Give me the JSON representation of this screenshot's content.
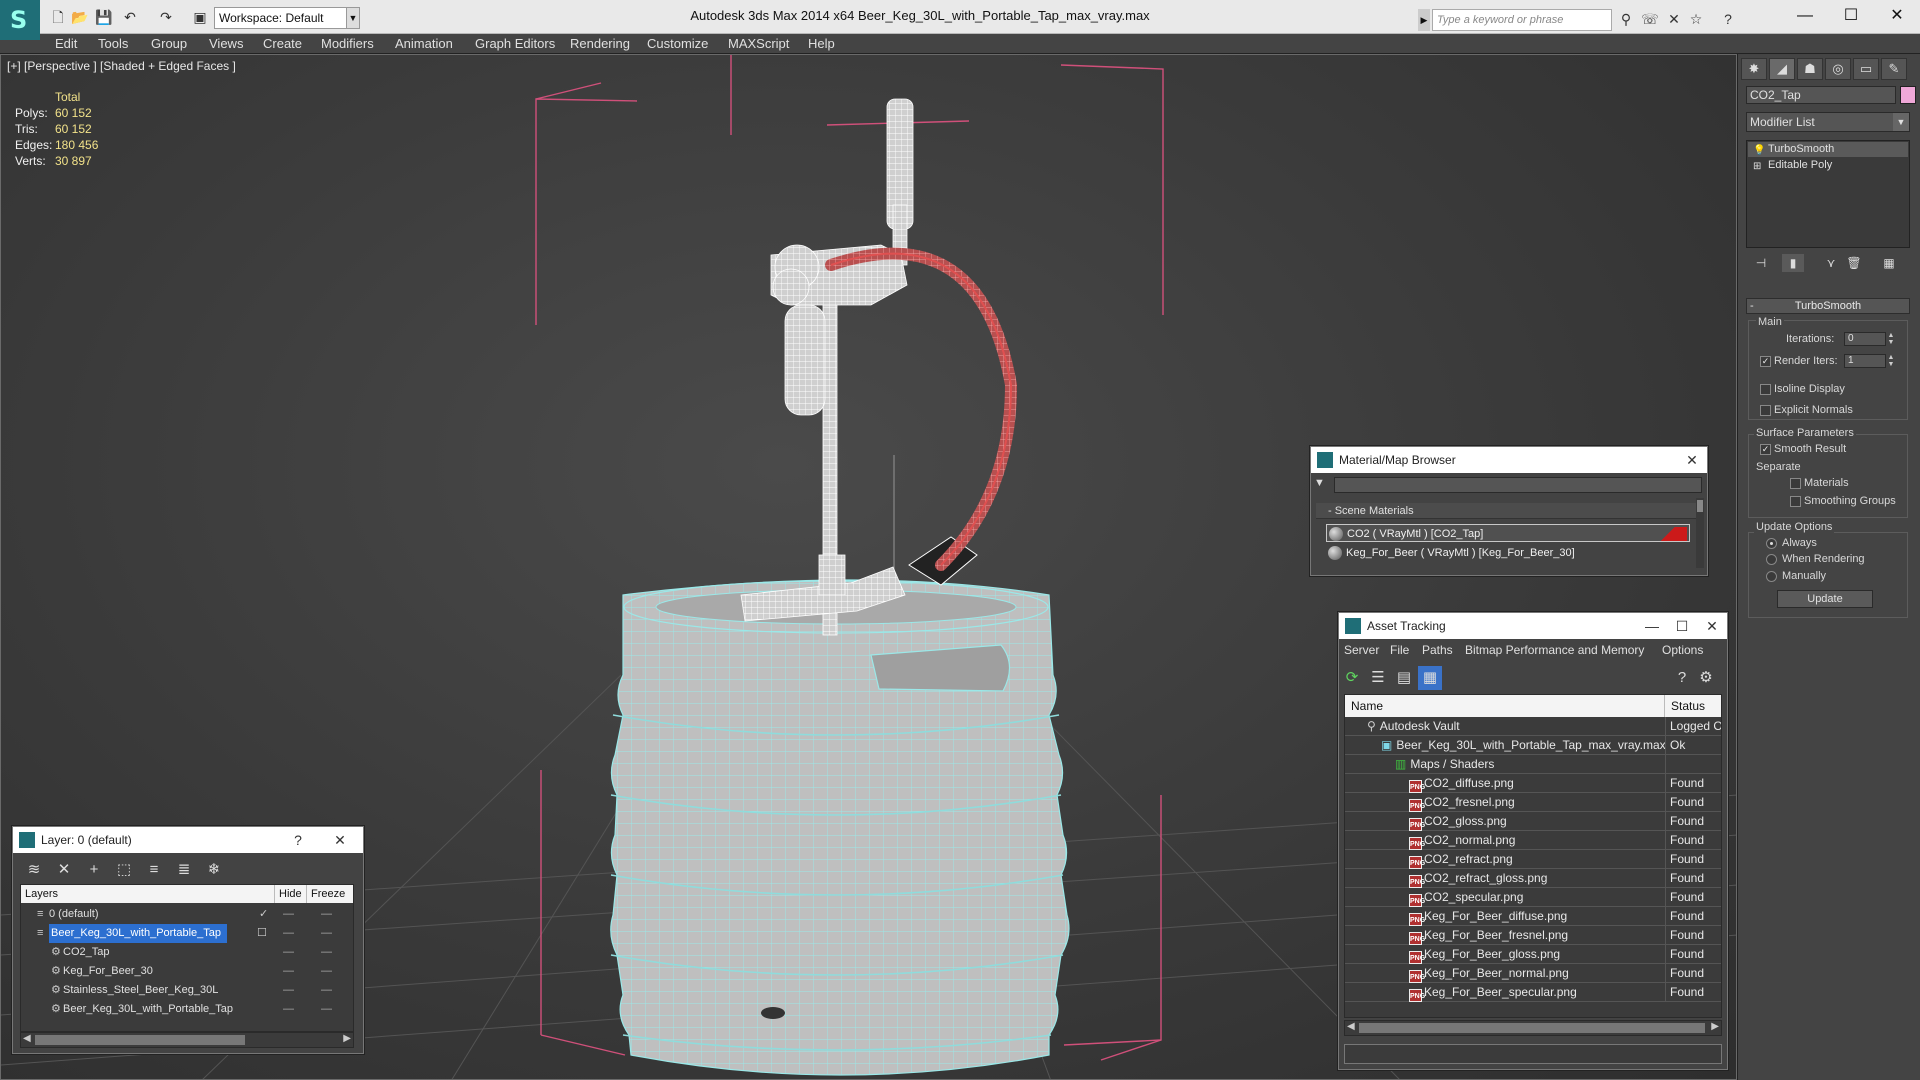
{
  "titlebar": {
    "workspace": "Workspace: Default",
    "title": "Autodesk 3ds Max  2014 x64     Beer_Keg_30L_with_Portable_Tap_max_vray.max",
    "search_placeholder": "Type a keyword or phrase"
  },
  "menu": [
    "Edit",
    "Tools",
    "Group",
    "Views",
    "Create",
    "Modifiers",
    "Animation",
    "Graph Editors",
    "Rendering",
    "Customize",
    "MAXScript",
    "Help"
  ],
  "viewport": {
    "label": "[+] [Perspective ] [Shaded + Edged Faces ]",
    "stats_header": "Total",
    "stats": [
      {
        "k": "Polys:",
        "v": "60 152"
      },
      {
        "k": "Tris:",
        "v": "60 152"
      },
      {
        "k": "Edges:",
        "v": "180 456"
      },
      {
        "k": "Verts:",
        "v": "30 897"
      }
    ],
    "colors": {
      "wire_keg": "#9be8e8",
      "wire_tap": "#ffffff",
      "hose": "#e05050",
      "bbox": "#d0507a"
    }
  },
  "cmd": {
    "object_name": "CO2_Tap",
    "object_color": "#f0a8d8",
    "modifier_list": "Modifier List",
    "stack": [
      "TurboSmooth",
      "Editable Poly"
    ],
    "turbosmooth": {
      "title": "TurboSmooth",
      "main": "Main",
      "iterations_label": "Iterations:",
      "iterations": "0",
      "render_iters_label": "Render Iters:",
      "render_iters": "1",
      "isoline": "Isoline Display",
      "explicit": "Explicit Normals",
      "surface": "Surface Parameters",
      "smooth_result": "Smooth Result",
      "separate": "Separate",
      "materials": "Materials",
      "smoothing_groups": "Smoothing Groups",
      "update_options": "Update Options",
      "always": "Always",
      "when_rendering": "When Rendering",
      "manually": "Manually",
      "update": "Update"
    }
  },
  "material_browser": {
    "title": "Material/Map Browser",
    "section": "- Scene Materials",
    "items": [
      {
        "label": "CO2  ( VRayMtl )  [CO2_Tap]",
        "swatch": "#cc1a1a"
      },
      {
        "label": "Keg_For_Beer  ( VRayMtl )  [Keg_For_Beer_30]",
        "swatch": ""
      }
    ]
  },
  "asset_tracking": {
    "title": "Asset Tracking",
    "menu": [
      "Server",
      "File",
      "Paths",
      "Bitmap Performance and Memory",
      "Options"
    ],
    "columns": [
      "Name",
      "Status"
    ],
    "rows": [
      {
        "name": "Autodesk Vault",
        "status": "Logged Out",
        "indent": 1,
        "icon": "vault"
      },
      {
        "name": "Beer_Keg_30L_with_Portable_Tap_max_vray.max",
        "status": "Ok",
        "indent": 2,
        "icon": "max"
      },
      {
        "name": "Maps / Shaders",
        "status": "",
        "indent": 3,
        "icon": "folder"
      },
      {
        "name": "CO2_diffuse.png",
        "status": "Found",
        "indent": 4,
        "icon": "png"
      },
      {
        "name": "CO2_fresnel.png",
        "status": "Found",
        "indent": 4,
        "icon": "png"
      },
      {
        "name": "CO2_gloss.png",
        "status": "Found",
        "indent": 4,
        "icon": "png"
      },
      {
        "name": "CO2_normal.png",
        "status": "Found",
        "indent": 4,
        "icon": "png"
      },
      {
        "name": "CO2_refract.png",
        "status": "Found",
        "indent": 4,
        "icon": "png"
      },
      {
        "name": "CO2_refract_gloss.png",
        "status": "Found",
        "indent": 4,
        "icon": "png"
      },
      {
        "name": "CO2_specular.png",
        "status": "Found",
        "indent": 4,
        "icon": "png"
      },
      {
        "name": "Keg_For_Beer_diffuse.png",
        "status": "Found",
        "indent": 4,
        "icon": "png"
      },
      {
        "name": "Keg_For_Beer_fresnel.png",
        "status": "Found",
        "indent": 4,
        "icon": "png"
      },
      {
        "name": "Keg_For_Beer_gloss.png",
        "status": "Found",
        "indent": 4,
        "icon": "png"
      },
      {
        "name": "Keg_For_Beer_normal.png",
        "status": "Found",
        "indent": 4,
        "icon": "png"
      },
      {
        "name": "Keg_For_Beer_specular.png",
        "status": "Found",
        "indent": 4,
        "icon": "png"
      }
    ]
  },
  "layer_dialog": {
    "title": "Layer: 0 (default)",
    "help": "?",
    "columns": [
      "Layers",
      "Hide",
      "Freeze"
    ],
    "rows": [
      {
        "name": "0 (default)",
        "indent": 1,
        "active": true,
        "selected": false
      },
      {
        "name": "Beer_Keg_30L_with_Portable_Tap",
        "indent": 1,
        "active": false,
        "selected": true
      },
      {
        "name": "CO2_Tap",
        "indent": 2,
        "active": false,
        "selected": false
      },
      {
        "name": "Keg_For_Beer_30",
        "indent": 2,
        "active": false,
        "selected": false
      },
      {
        "name": "Stainless_Steel_Beer_Keg_30L",
        "indent": 2,
        "active": false,
        "selected": false
      },
      {
        "name": "Beer_Keg_30L_with_Portable_Tap",
        "indent": 2,
        "active": false,
        "selected": false
      }
    ]
  }
}
